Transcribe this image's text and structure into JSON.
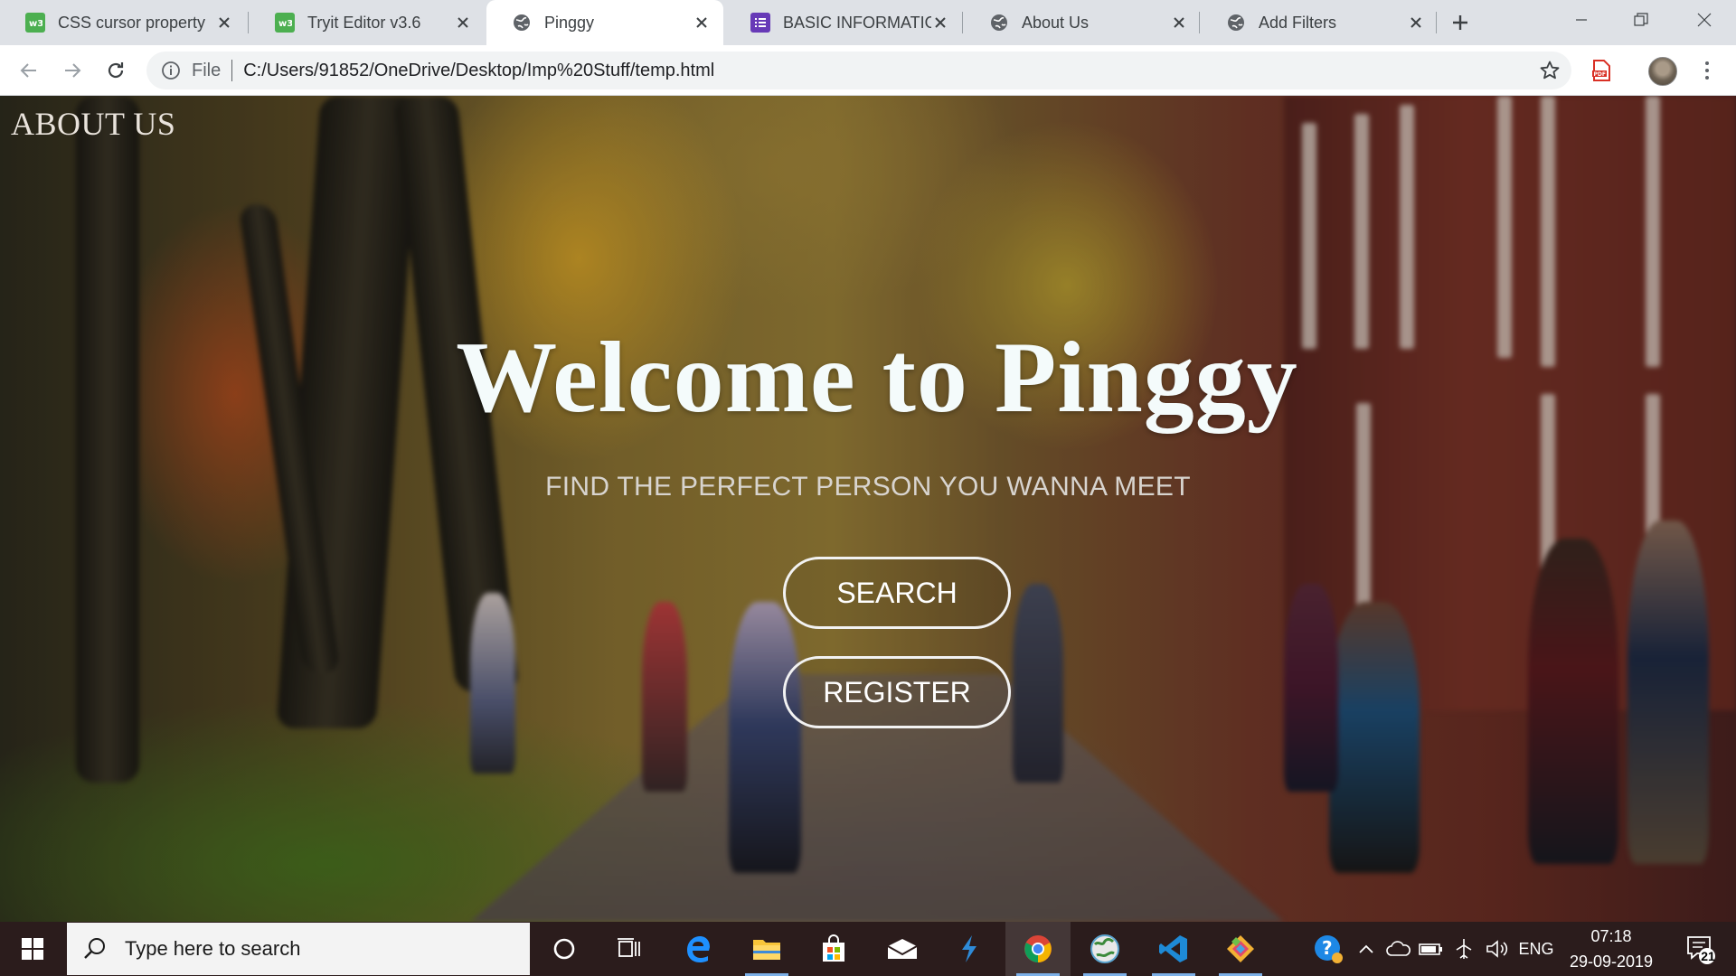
{
  "browser": {
    "tabs": [
      {
        "title": "CSS cursor property",
        "favicon": "w3schools-icon",
        "active": false
      },
      {
        "title": "Tryit Editor v3.6",
        "favicon": "w3schools-icon",
        "active": false
      },
      {
        "title": "Pinggy",
        "favicon": "globe-icon",
        "active": true
      },
      {
        "title": "BASIC INFORMATION",
        "favicon": "forms-icon",
        "active": false
      },
      {
        "title": "About Us",
        "favicon": "globe-icon",
        "active": false
      },
      {
        "title": "Add Filters",
        "favicon": "globe-icon",
        "active": false
      }
    ],
    "address": {
      "scheme_label": "File",
      "url": "C:/Users/91852/OneDrive/Desktop/Imp%20Stuff/temp.html"
    }
  },
  "page": {
    "about_link": "ABOUT US",
    "title": "Welcome to Pinggy",
    "subtitle": "FIND THE PERFECT PERSON YOU WANNA MEET",
    "search_button": "SEARCH",
    "register_button": "REGISTER"
  },
  "taskbar": {
    "search_placeholder": "Type here to search",
    "language": "ENG",
    "time": "07:18",
    "date": "29-09-2019",
    "notification_count": "21"
  },
  "colors": {
    "tab_strip": "#dee1e6",
    "taskbar": "#2b1c1c",
    "title_text": "#f4fbfb",
    "chrome_blue": "#1a73e8"
  }
}
